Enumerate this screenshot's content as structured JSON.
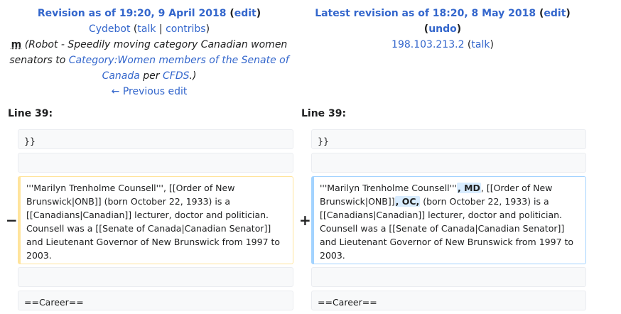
{
  "left_header": {
    "title_prefix": "Revision as of 19:20, 9 April 2018",
    "edit_label": "edit",
    "user": "Cydebot",
    "talk": "talk",
    "contribs": "contribs",
    "minor_flag": "m",
    "summary_before": "(Robot - Speedily moving category Canadian women senators to ",
    "summary_link": "Category:Women members of the Senate of Canada",
    "summary_mid": " per ",
    "summary_link2": "CFDS",
    "summary_after": ".)",
    "previous_edit": "← Previous edit"
  },
  "right_header": {
    "title_prefix": "Latest revision as of 18:20, 8 May 2018",
    "edit_label": "edit",
    "undo_label": "undo",
    "user": "198.103.213.2",
    "talk": "talk"
  },
  "diff": {
    "line_label_left": "Line 39:",
    "line_label_right": "Line 39:",
    "context_top": "}}",
    "context_bottom": "==Career==",
    "minus_marker": "−",
    "plus_marker": "+",
    "deleted_text": "'''Marilyn Trenholme Counsell''', [[Order of New Brunswick|ONB]] (born October 22, 1933) is a [[Canadians|Canadian]] lecturer, doctor and politician. Counsell was a [[Senate of Canada|Canadian Senator]] and Lieutenant Governor of New Brunswick from 1997 to 2003.",
    "added": {
      "part1": "'''Marilyn Trenholme Counsell'''",
      "ins1": ", MD",
      "part2": ", [[Order of New Brunswick|ONB]]",
      "ins2": ", OC,",
      "part3": " (born October 22, 1933) is a [[Canadians|Canadian]] lecturer, doctor and politician. Counsell was a [[Senate of Canada|Canadian Senator]] and Lieutenant Governor of New Brunswick from 1997 to 2003."
    }
  },
  "colors": {
    "link": "#3366cc",
    "deleted_border": "#ffe49c",
    "added_border": "#a3d3ff",
    "inserted_highlight": "#d8ecff"
  }
}
